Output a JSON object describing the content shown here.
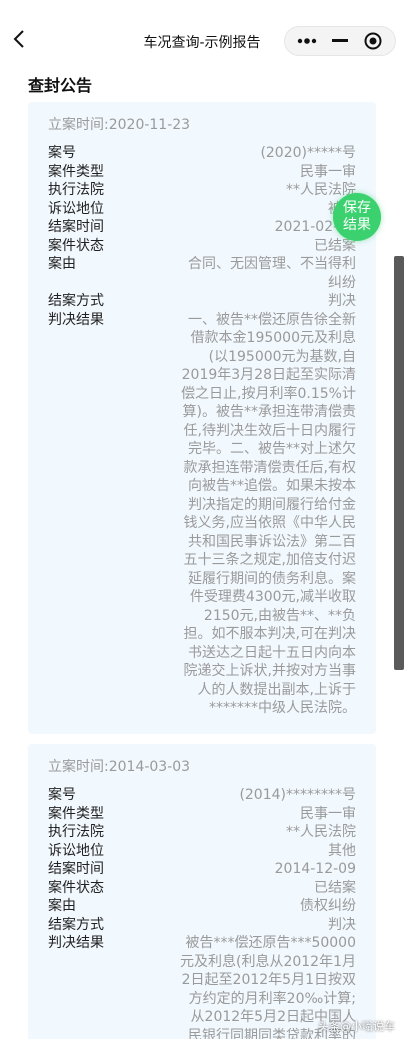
{
  "nav": {
    "title": "车况查询-示例报告"
  },
  "section": {
    "title": "查封公告"
  },
  "fab": {
    "label": "保存结果"
  },
  "cards": [
    {
      "date": "立案时间:2020-11-23",
      "rows": [
        {
          "label": "案号",
          "value": "(2020)*****号"
        },
        {
          "label": "案件类型",
          "value": "民事一审"
        },
        {
          "label": "执行法院",
          "value": "**人民法院"
        },
        {
          "label": "诉讼地位",
          "value": "被告"
        },
        {
          "label": "结案时间",
          "value": "2021-02-01"
        },
        {
          "label": "案件状态",
          "value": "已结案"
        },
        {
          "label": "案由",
          "value": "合同、无因管理、不当得利纠纷"
        },
        {
          "label": "结案方式",
          "value": "判决"
        },
        {
          "label": "判决结果",
          "value": "一、被告**偿还原告徐全新借款本金195000元及利息(以195000元为基数,自2019年3月28日起至实际清偿之日止,按月利率0.15%计算)。被告**承担连带清偿责任,待判决生效后十日内履行完毕。二、被告**对上述欠款承担连带清偿责任后,有权向被告**追偿。如果未按本判决指定的期间履行给付金钱义务,应当依照《中华人民共和国民事诉讼法》第二百五十三条之规定,加倍支付迟延履行期间的债务利息。案件受理费4300元,减半收取2150元,由被告**、**负担。如不服本判决,可在判决书送达之日起十五日内向本院递交上诉状,并按对方当事人的人数提出副本,上诉于*******中级人民法院。"
        }
      ]
    },
    {
      "date": "立案时间:2014-03-03",
      "rows": [
        {
          "label": "案号",
          "value": "(2014)********号"
        },
        {
          "label": "案件类型",
          "value": "民事一审"
        },
        {
          "label": "执行法院",
          "value": "**人民法院"
        },
        {
          "label": "诉讼地位",
          "value": "其他"
        },
        {
          "label": "结案时间",
          "value": "2014-12-09"
        },
        {
          "label": "案件状态",
          "value": "已结案"
        },
        {
          "label": "案由",
          "value": "债权纠纷"
        },
        {
          "label": "结案方式",
          "value": "判决"
        },
        {
          "label": "判决结果",
          "value": "被告***偿还原告***50000元及利息(利息从2012年1月2日起至2012年5月1日按双方约定的月利率20‰计算;从2012年5月2日起中国人民银行同期同类贷款利率的四"
        }
      ]
    }
  ],
  "watermark": {
    "text": "头条@小嗡说车"
  }
}
